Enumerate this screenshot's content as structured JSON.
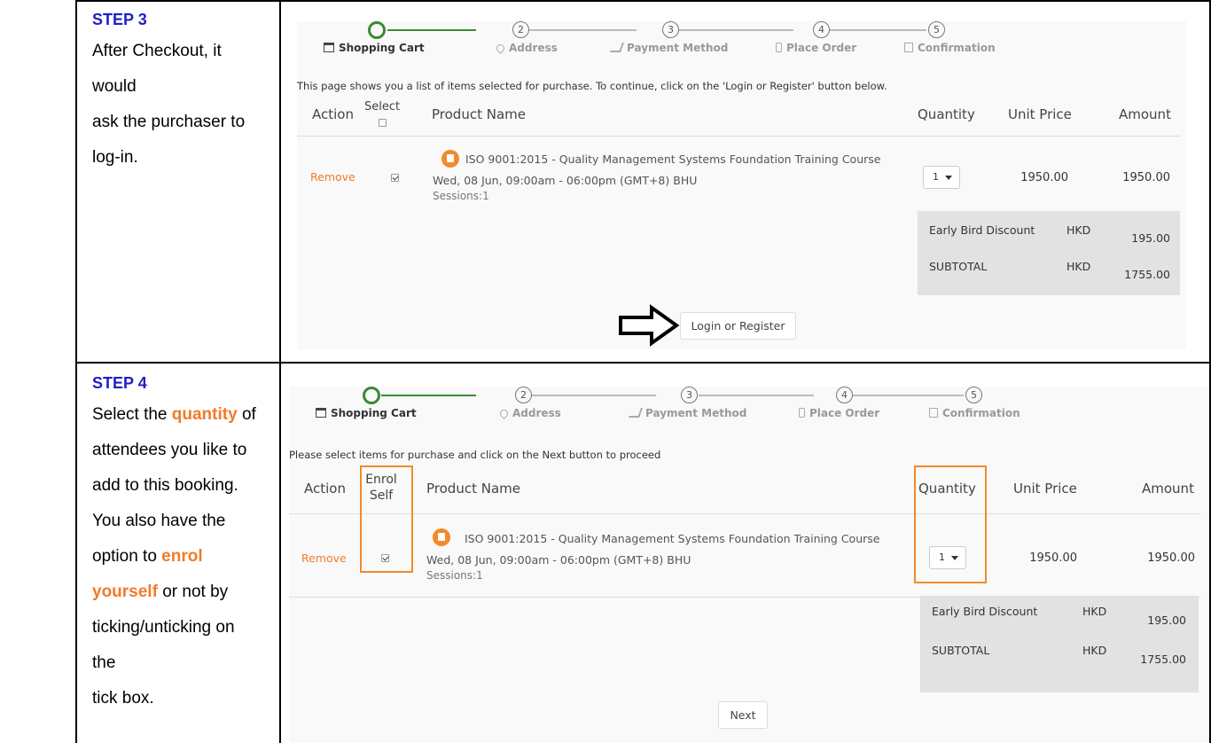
{
  "step3": {
    "title": "STEP 3",
    "lines": [
      "After Checkout, it would",
      "ask the purchaser to",
      "log-in."
    ],
    "screenshot": {
      "steps": [
        {
          "num": "",
          "label": "Shopping Cart",
          "icon": "cart-icon"
        },
        {
          "num": "2",
          "label": "Address",
          "icon": "map-pin-icon"
        },
        {
          "num": "3",
          "label": "Payment Method",
          "icon": "pencil-icon"
        },
        {
          "num": "4",
          "label": "Place Order",
          "icon": "phone-icon"
        },
        {
          "num": "5",
          "label": "Confirmation",
          "icon": "document-check-icon"
        }
      ],
      "intro": "This page shows you a list of items selected for purchase. To continue, click on the 'Login or Register' button below.",
      "headers": {
        "action": "Action",
        "select": "Select",
        "product": "Product Name",
        "quantity": "Quantity",
        "unit_price": "Unit Price",
        "amount": "Amount"
      },
      "item": {
        "remove": "Remove",
        "name": "ISO 9001:2015 - Quality Management Systems Foundation Training Course",
        "date": "Wed, 08 Jun, 09:00am - 06:00pm (GMT+8) BHU",
        "sessions": "Sessions:1",
        "quantity": "1",
        "unit_price": "1950.00",
        "amount": "1950.00",
        "checked": true
      },
      "totals": [
        {
          "label": "Early Bird Discount",
          "currency": "HKD",
          "value": "195.00"
        },
        {
          "label": "SUBTOTAL",
          "currency": "HKD",
          "value": "1755.00"
        }
      ],
      "button": "Login or Register"
    }
  },
  "step4": {
    "title": "STEP 4",
    "screenshot": {
      "intro": "Please select items for purchase and click on the Next button to proceed",
      "headers": {
        "action": "Action",
        "enrol": "Enrol",
        "self": "Self",
        "product": "Product Name",
        "quantity": "Quantity",
        "unit_price": "Unit Price",
        "amount": "Amount"
      },
      "button": "Next"
    }
  },
  "colors": {
    "step_title": "#1f1fc4",
    "highlight": "#f27b29",
    "active_step": "#3a8a36"
  }
}
